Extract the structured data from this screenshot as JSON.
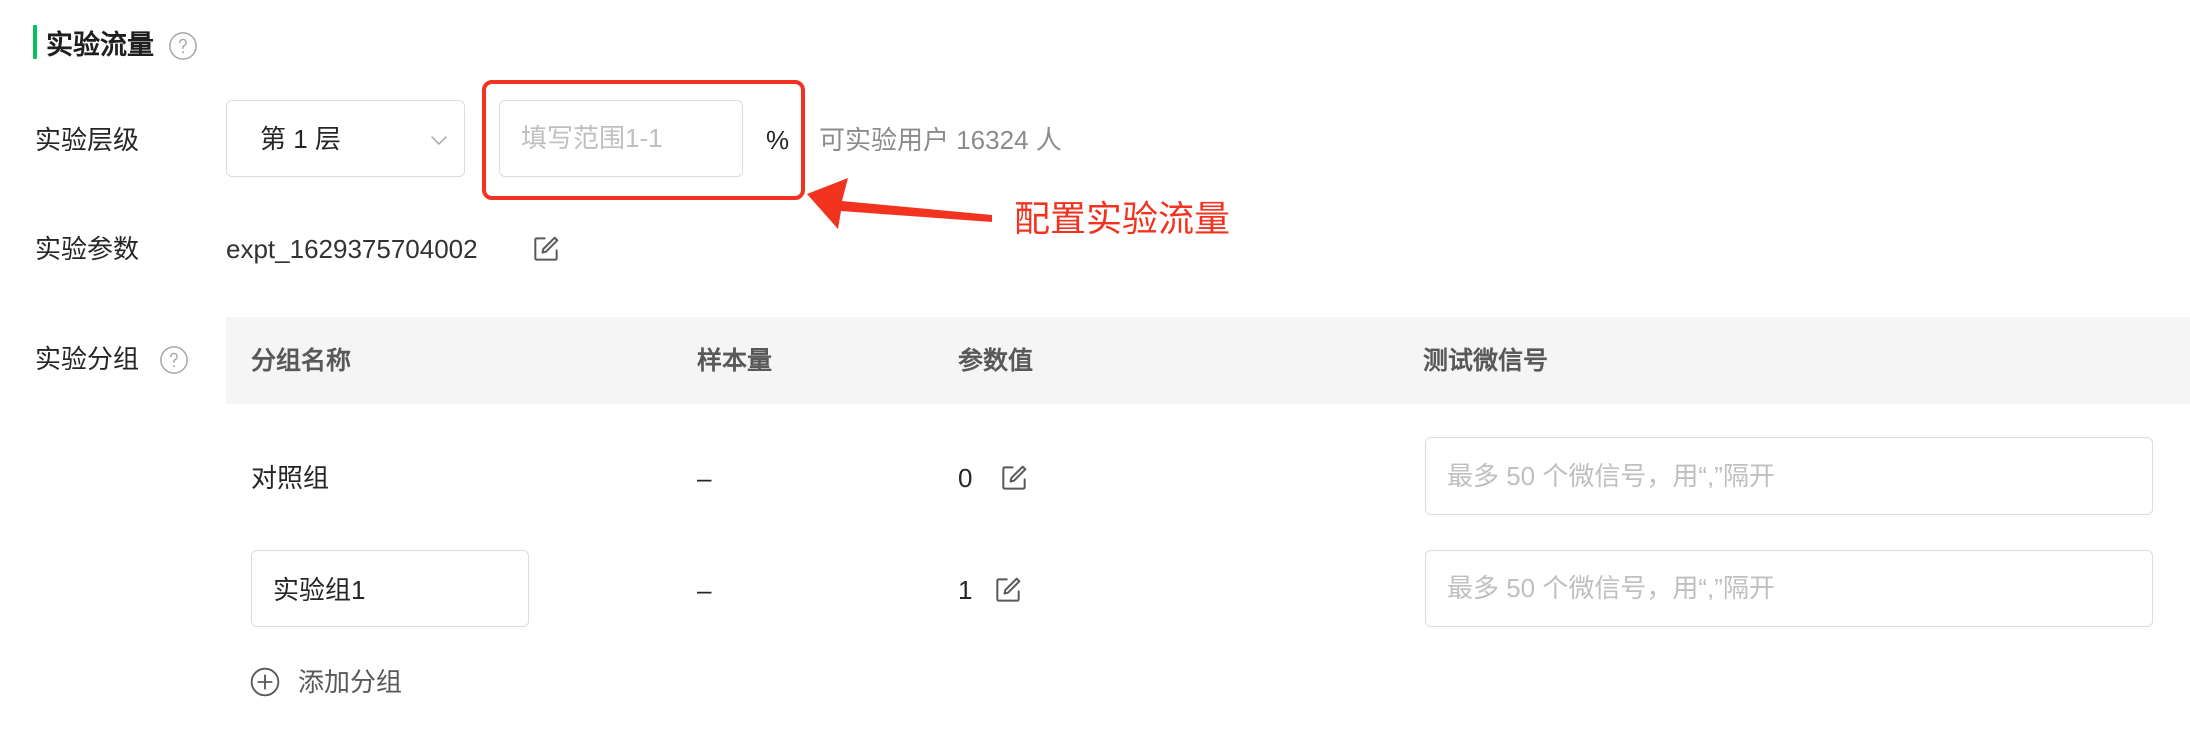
{
  "colors": {
    "accent": "#07c160",
    "annotation": "#f2331f",
    "table_header_bg": "#f5f5f5"
  },
  "icons": {
    "help": "question-circle-icon",
    "select": "chevron-down-icon",
    "edit": "edit-icon",
    "add": "plus-circle-icon",
    "annotation_arrow": "arrow-icon"
  },
  "section": {
    "title": "实验流量"
  },
  "layer": {
    "label": "实验层级",
    "select_value": "第 1 层",
    "traffic_placeholder": "填写范围1-1",
    "percent_sign": "%",
    "available_users": "可实验用户 16324 人"
  },
  "annotation": {
    "text": "配置实验流量"
  },
  "param": {
    "label": "实验参数",
    "value": "expt_1629375704002"
  },
  "groups": {
    "label": "实验分组",
    "columns": [
      "分组名称",
      "样本量",
      "参数值",
      "测试微信号"
    ],
    "rows": [
      {
        "name": "对照组",
        "sample": "–",
        "param_value": "0",
        "wechat_placeholder": "最多 50 个微信号，用“,”隔开"
      },
      {
        "name": "实验组1",
        "sample": "–",
        "param_value": "1",
        "wechat_placeholder": "最多 50 个微信号，用“,”隔开"
      }
    ],
    "add_label": "添加分组"
  }
}
